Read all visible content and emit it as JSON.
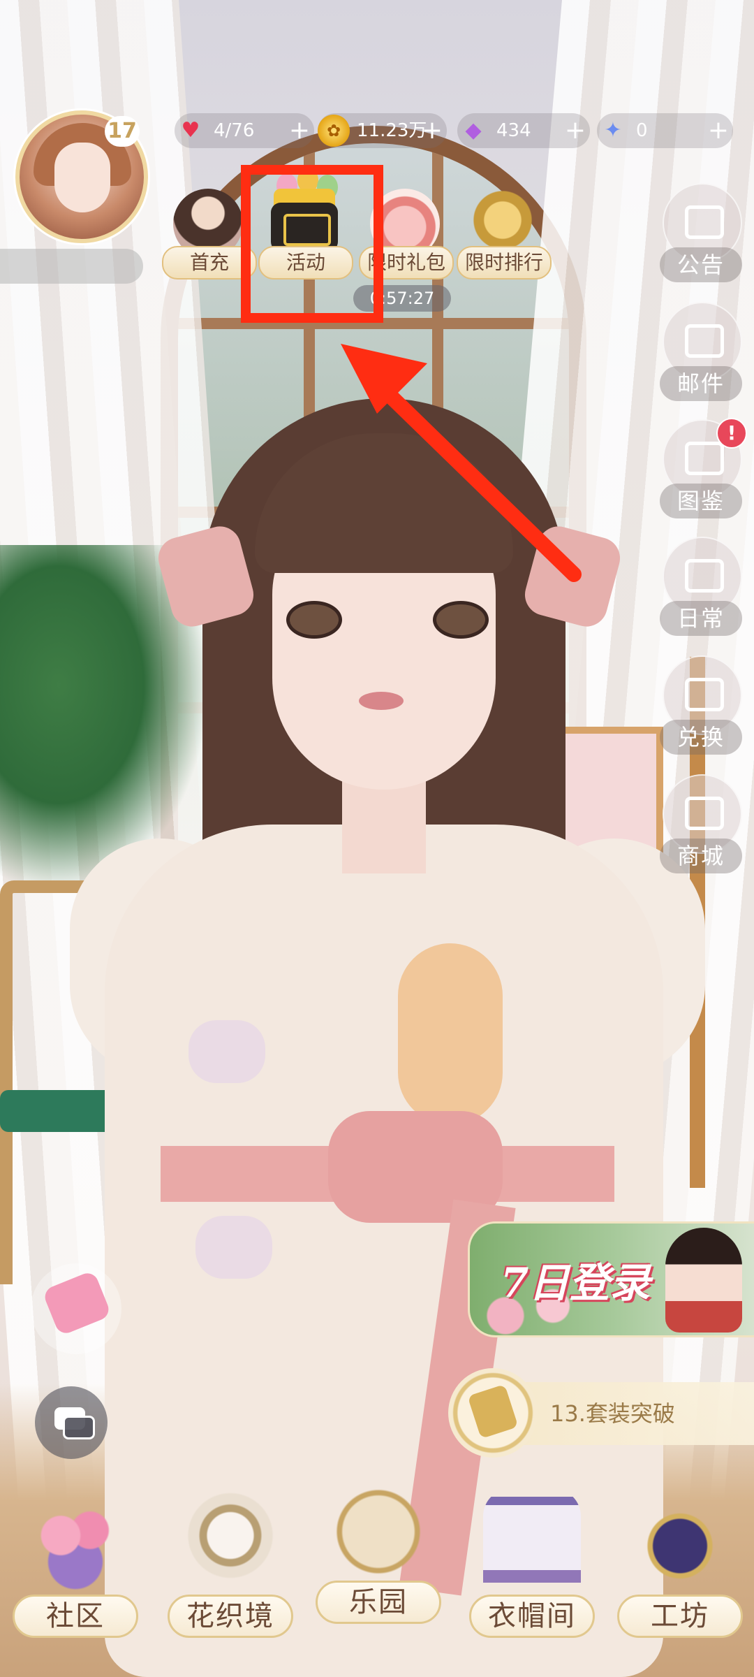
{
  "player": {
    "level": "17"
  },
  "currencies": {
    "stamina": {
      "icon": "heart-icon",
      "value": "4/76",
      "color": "#e8334f"
    },
    "gold": {
      "icon": "coin-icon",
      "value": "11.23万",
      "color": "#e5a516"
    },
    "diamond": {
      "icon": "gem-icon",
      "value": "434",
      "color": "#b05ee0"
    },
    "star": {
      "icon": "star-icon",
      "value": "0",
      "color": "#6b8cf0"
    },
    "plus_glyph": "+"
  },
  "events": [
    {
      "label": "首充",
      "icon": "first-charge-icon"
    },
    {
      "label": "活动",
      "icon": "gift-box-icon"
    },
    {
      "label": "限时礼包",
      "icon": "gift-bag-icon",
      "timer": "0:57:27"
    },
    {
      "label": "限时排行",
      "icon": "trophy-icon"
    }
  ],
  "side_menu": [
    {
      "label": "公告",
      "icon": "notice-board-icon"
    },
    {
      "label": "邮件",
      "icon": "mail-icon"
    },
    {
      "label": "图鉴",
      "icon": "album-icon",
      "badge": "!"
    },
    {
      "label": "日常",
      "icon": "daily-book-icon"
    },
    {
      "label": "兑换",
      "icon": "shop-stall-icon"
    },
    {
      "label": "商城",
      "icon": "diamond-shop-icon"
    }
  ],
  "promo": {
    "login_banner_title": "7日登录",
    "quest_text": "13.套装突破"
  },
  "bottom_nav": [
    {
      "label": "社区",
      "icon": "community-icon"
    },
    {
      "label": "花织境",
      "icon": "flower-weave-icon"
    },
    {
      "label": "乐园",
      "icon": "park-book-icon"
    },
    {
      "label": "衣帽间",
      "icon": "wardrobe-mirror-icon"
    },
    {
      "label": "工坊",
      "icon": "workshop-icon"
    }
  ],
  "annotation": {
    "highlight_color": "#ff2d12"
  }
}
